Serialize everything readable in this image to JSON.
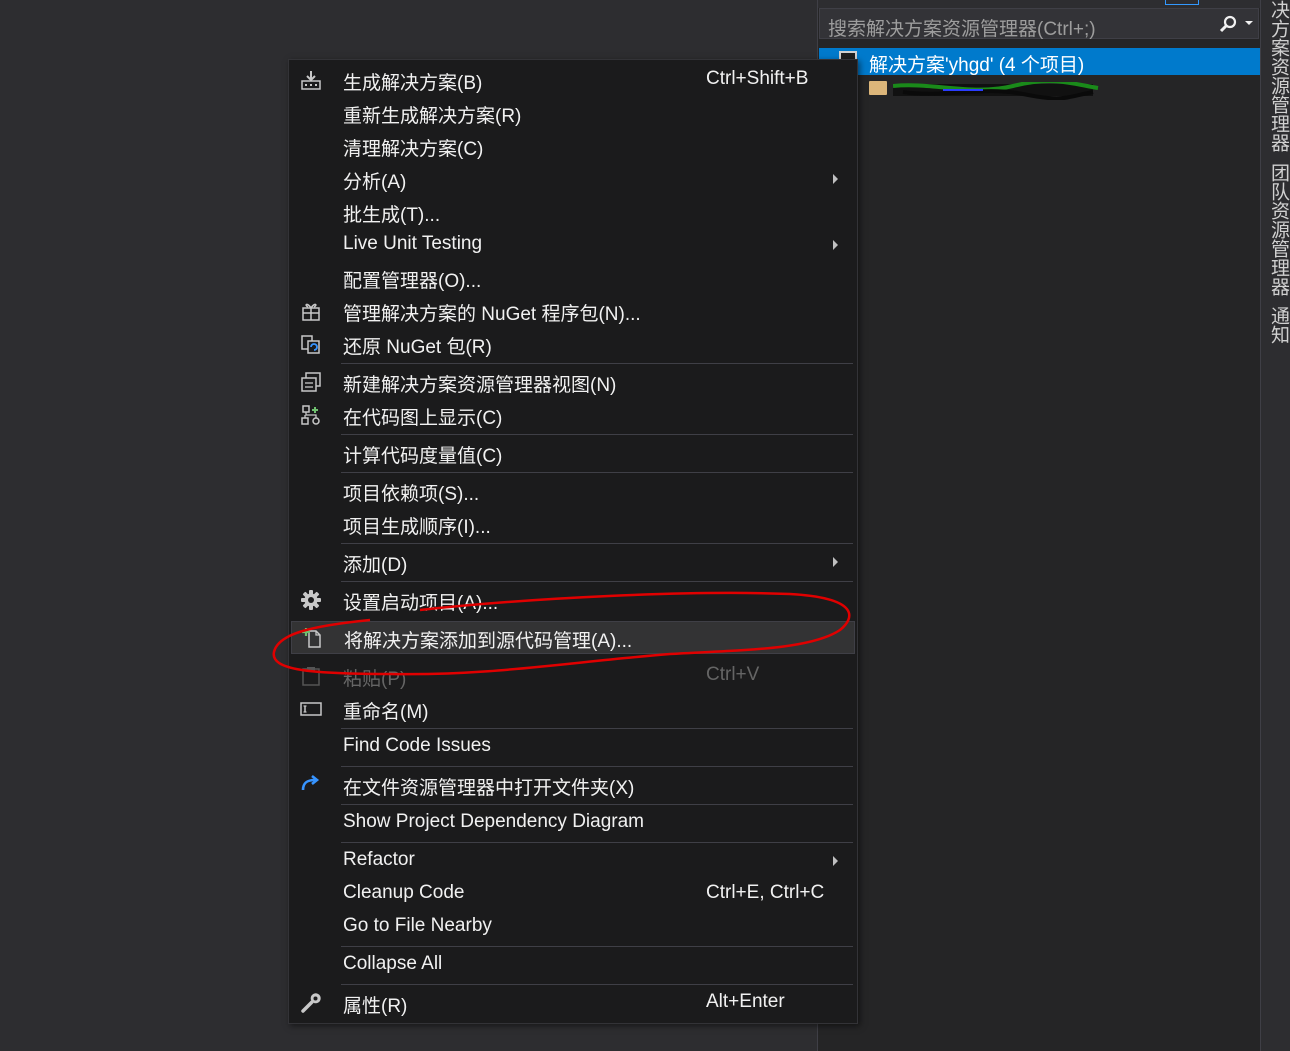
{
  "explorer": {
    "search_placeholder": "搜索解决方案资源管理器(Ctrl+;)",
    "solution_label": "解决方案'yhgd' (4 个项目)",
    "project_label_redacted": "(redacted)"
  },
  "side_tabs": [
    "决方案资源管理器",
    "团队资源管理器",
    "通知"
  ],
  "menu": {
    "items": [
      {
        "label": "生成解决方案(B)",
        "shortcut": "Ctrl+Shift+B",
        "icon": "build-icon",
        "submenu": false,
        "disabled": false
      },
      {
        "label": "重新生成解决方案(R)",
        "shortcut": "",
        "icon": "",
        "submenu": false,
        "disabled": false
      },
      {
        "label": "清理解决方案(C)",
        "shortcut": "",
        "icon": "",
        "submenu": false,
        "disabled": false
      },
      {
        "label": "分析(A)",
        "shortcut": "",
        "icon": "",
        "submenu": true,
        "disabled": false
      },
      {
        "label": "批生成(T)...",
        "shortcut": "",
        "icon": "",
        "submenu": false,
        "disabled": false
      },
      {
        "label": "Live Unit Testing",
        "shortcut": "",
        "icon": "",
        "submenu": true,
        "disabled": false
      },
      {
        "label": "配置管理器(O)...",
        "shortcut": "",
        "icon": "",
        "submenu": false,
        "disabled": false
      },
      {
        "label": "管理解决方案的 NuGet 程序包(N)...",
        "shortcut": "",
        "icon": "nuget-package-icon",
        "submenu": false,
        "disabled": false
      },
      {
        "label": "还原 NuGet 包(R)",
        "shortcut": "",
        "icon": "restore-icon",
        "submenu": false,
        "disabled": false
      },
      {
        "label": "新建解决方案资源管理器视图(N)",
        "shortcut": "",
        "icon": "new-view-icon",
        "submenu": false,
        "disabled": false
      },
      {
        "label": "在代码图上显示(C)",
        "shortcut": "",
        "icon": "code-map-icon",
        "submenu": false,
        "disabled": false
      },
      {
        "label": "计算代码度量值(C)",
        "shortcut": "",
        "icon": "",
        "submenu": false,
        "disabled": false
      },
      {
        "label": "项目依赖项(S)...",
        "shortcut": "",
        "icon": "",
        "submenu": false,
        "disabled": false
      },
      {
        "label": "项目生成顺序(I)...",
        "shortcut": "",
        "icon": "",
        "submenu": false,
        "disabled": false
      },
      {
        "label": "添加(D)",
        "shortcut": "",
        "icon": "",
        "submenu": true,
        "disabled": false
      },
      {
        "label": "设置启动项目(A)...",
        "shortcut": "",
        "icon": "gear-icon",
        "submenu": false,
        "disabled": false
      },
      {
        "label": "将解决方案添加到源代码管理(A)...",
        "shortcut": "",
        "icon": "add-source-control-icon",
        "submenu": false,
        "disabled": false,
        "highlighted": true
      },
      {
        "label": "粘贴(P)",
        "shortcut": "Ctrl+V",
        "icon": "paste-icon",
        "submenu": false,
        "disabled": true
      },
      {
        "label": "重命名(M)",
        "shortcut": "",
        "icon": "rename-icon",
        "submenu": false,
        "disabled": false
      },
      {
        "label": "Find Code Issues",
        "shortcut": "",
        "icon": "",
        "submenu": false,
        "disabled": false
      },
      {
        "label": "在文件资源管理器中打开文件夹(X)",
        "shortcut": "",
        "icon": "open-folder-arrow-icon",
        "submenu": false,
        "disabled": false
      },
      {
        "label": "Show Project Dependency Diagram",
        "shortcut": "",
        "icon": "",
        "submenu": false,
        "disabled": false
      },
      {
        "label": "Refactor",
        "shortcut": "",
        "icon": "",
        "submenu": true,
        "disabled": false
      },
      {
        "label": "Cleanup Code",
        "shortcut": "Ctrl+E, Ctrl+C",
        "icon": "",
        "submenu": false,
        "disabled": false
      },
      {
        "label": "Go to File Nearby",
        "shortcut": "",
        "icon": "",
        "submenu": false,
        "disabled": false
      },
      {
        "label": "Collapse All",
        "shortcut": "",
        "icon": "",
        "submenu": false,
        "disabled": false
      },
      {
        "label": "属性(R)",
        "shortcut": "Alt+Enter",
        "icon": "wrench-icon",
        "submenu": false,
        "disabled": false
      }
    ]
  },
  "colors": {
    "selection": "#007acc",
    "annotation": "#e00000",
    "scribble_green": "#1a8a1a"
  }
}
